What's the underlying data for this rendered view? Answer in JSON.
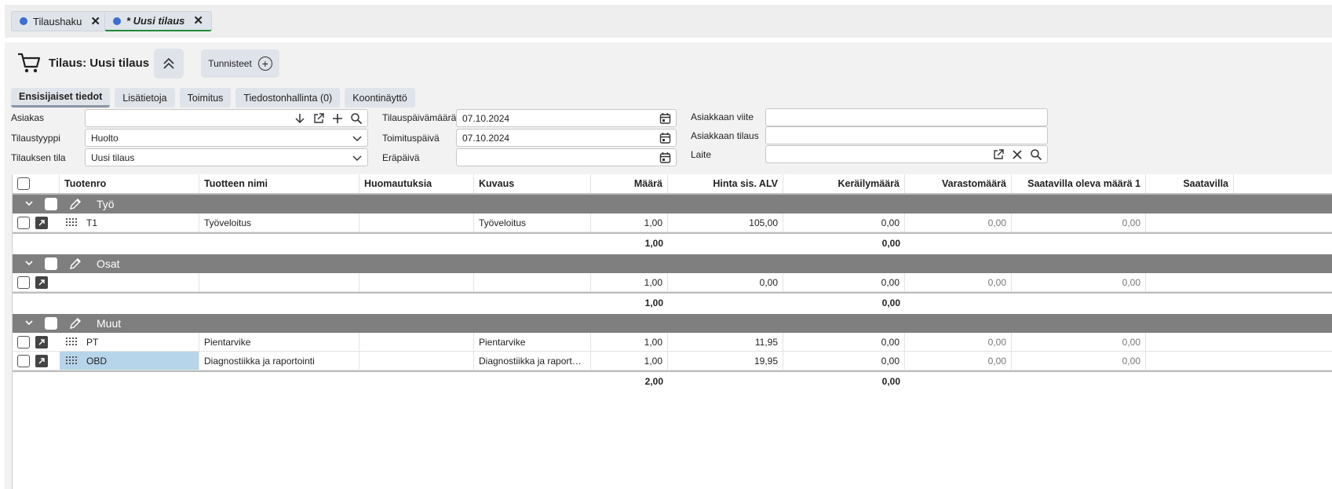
{
  "doc_tabs": [
    {
      "label": "Tilaushaku"
    },
    {
      "label": "* Uusi tilaus"
    }
  ],
  "header": {
    "title": "Tilaus: Uusi tilaus",
    "tags_label": "Tunnisteet"
  },
  "subtabs": [
    "Ensisijaiset tiedot",
    "Lisätietoja",
    "Toimitus",
    "Tiedostonhallinta (0)",
    "Koontinäyttö"
  ],
  "form": {
    "asiakas_label": "Asiakas",
    "asiakas_value": "",
    "tilaustyyppi_label": "Tilaustyyppi",
    "tilaustyyppi_value": "Huolto",
    "tila_label": "Tilauksen tila",
    "tila_value": "Uusi tilaus",
    "tilauspvm_label": "Tilauspäivämäärä",
    "tilauspvm_value": "07.10.2024",
    "toimituspvm_label": "Toimituspäivä",
    "toimituspvm_value": "07.10.2024",
    "erapaiva_label": "Eräpäivä",
    "erapaiva_value": "",
    "viite_label": "Asiakkaan viite",
    "viite_value": "",
    "asiakkaan_tilaus_label": "Asiakkaan tilaus",
    "asiakkaan_tilaus_value": "",
    "laite_label": "Laite",
    "laite_value": ""
  },
  "grid": {
    "columns": [
      "Tuotenro",
      "Tuotteen nimi",
      "Huomautuksia",
      "Kuvaus",
      "Määrä",
      "Hinta sis. ALV",
      "Keräilymäärä",
      "Varastomäärä",
      "Saatavilla oleva määrä 1",
      "Saatavilla"
    ],
    "groups": [
      {
        "name": "Työ",
        "rows": [
          {
            "tuotenro": "T1",
            "nimi": "Työveloitus",
            "huom": "",
            "kuvaus": "Työveloitus",
            "maara": "1,00",
            "hinta": "105,00",
            "keraily": "0,00",
            "varasto": "0,00",
            "saatavilla1": "0,00"
          }
        ],
        "sum_maara": "1,00",
        "sum_keraily": "0,00"
      },
      {
        "name": "Osat",
        "rows": [
          {
            "tuotenro": "",
            "nimi": "",
            "huom": "",
            "kuvaus": "",
            "maara": "1,00",
            "hinta": "0,00",
            "keraily": "0,00",
            "varasto": "0,00",
            "saatavilla1": "0,00"
          }
        ],
        "sum_maara": "1,00",
        "sum_keraily": "0,00"
      },
      {
        "name": "Muut",
        "rows": [
          {
            "tuotenro": "PT",
            "nimi": "Pientarvike",
            "huom": "",
            "kuvaus": "Pientarvike",
            "maara": "1,00",
            "hinta": "11,95",
            "keraily": "0,00",
            "varasto": "0,00",
            "saatavilla1": "0,00"
          },
          {
            "tuotenro": "OBD",
            "nimi": "Diagnostiikka ja raportointi",
            "huom": "",
            "kuvaus": "Diagnostiikka ja raport…",
            "maara": "1,00",
            "hinta": "19,95",
            "keraily": "0,00",
            "varasto": "0,00",
            "saatavilla1": "0,00"
          }
        ],
        "sum_maara": "2,00",
        "sum_keraily": "0,00"
      }
    ]
  },
  "colors": {
    "accent": "#3b6fd1",
    "active_tab_underline": "#1f8a3a",
    "group_header": "#7f7f7f",
    "selected_cell": "#b7d5ea"
  }
}
